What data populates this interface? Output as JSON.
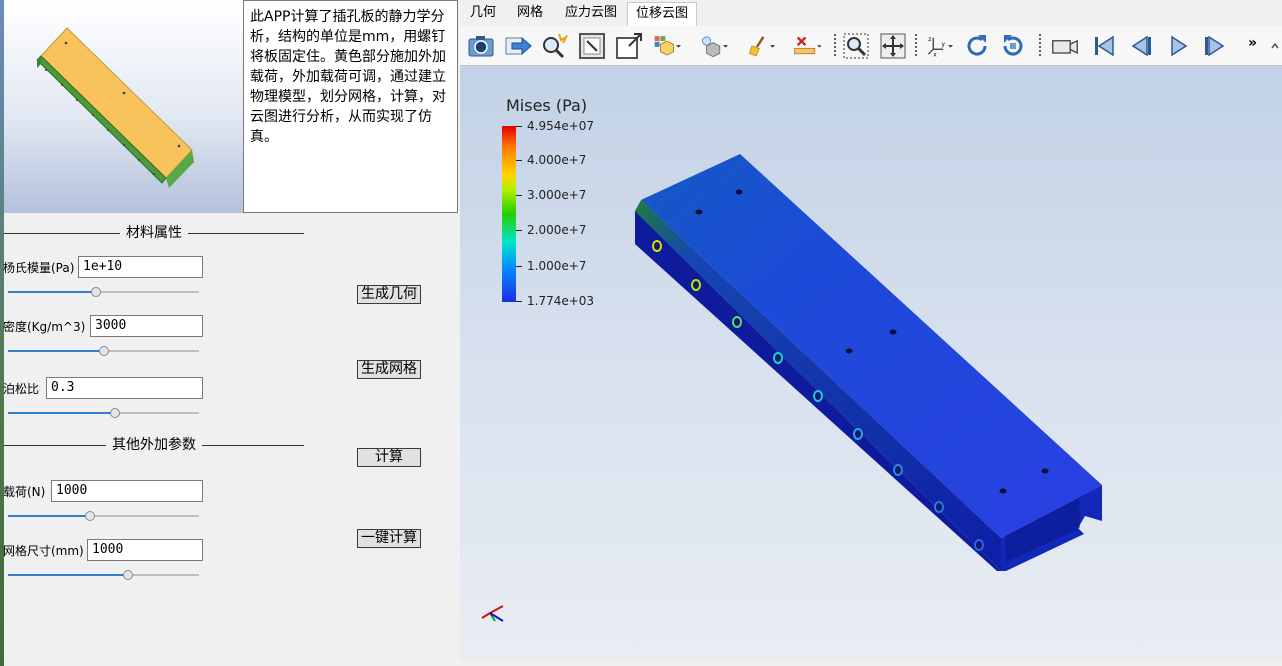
{
  "description": "此APP计算了插孔板的静力学分析，结构的单位是mm，用螺钉将板固定住。黄色部分施加外加载荷，外加载荷可调，通过建立物理模型，划分网格，计算，对云图进行分析，从而实现了仿真。",
  "section_material": "材料属性",
  "section_other": "其他外加参数",
  "fields": [
    {
      "label": "杨氏模量(Pa)",
      "value": "1e+10",
      "slider_fraction": 0.46
    },
    {
      "label": "密度(Kg/m^3)",
      "value": "3000",
      "slider_fraction": 0.5
    },
    {
      "label": "泊松比",
      "value": "0.3",
      "slider_fraction": 0.56
    },
    {
      "label": "载荷(N)",
      "value": "1000",
      "slider_fraction": 0.43
    },
    {
      "label": "网格尺寸(mm)",
      "value": "1000",
      "slider_fraction": 0.63
    }
  ],
  "buttons": {
    "gen_geometry": "生成几何",
    "gen_mesh": "生成网格",
    "compute": "计算",
    "one_click": "一键计算"
  },
  "tabs": [
    {
      "label": "几何",
      "active": false
    },
    {
      "label": "网格",
      "active": false
    },
    {
      "label": "应力云图",
      "active": false
    },
    {
      "label": "位移云图",
      "active": true
    }
  ],
  "toolbar": {
    "icons": [
      "camera-icon",
      "export-arrow-icon",
      "zoom-select-icon",
      "zoom-extents-icon",
      "zoom-box-icon",
      "views-dropdown-icon",
      "transparency-dropdown-icon",
      "clear-broom-icon",
      "delete-measure-icon",
      "zoom-window-icon",
      "move-icon",
      "axes-dropdown-icon",
      "rotate-cw-icon",
      "rotate-ccw-icon",
      "video-camera-icon",
      "first-frame-icon",
      "prev-frame-icon",
      "play-icon",
      "next-frame-icon"
    ],
    "overflow_glyph": "»"
  },
  "legend": {
    "title": "Mises (Pa)",
    "ticks": [
      "4.954e+07",
      "4.000e+7",
      "3.000e+7",
      "2.000e+7",
      "1.000e+7",
      "1.774e+03"
    ],
    "tick_values": [
      49540000,
      40000000,
      30000000,
      20000000,
      10000000,
      1774
    ],
    "colors": {
      "max": "#e00000",
      "mid": "#22d000",
      "min": "#1d2de6"
    }
  },
  "preview_colors": {
    "top": "#f8c35b",
    "side": "#4c9a3c"
  }
}
